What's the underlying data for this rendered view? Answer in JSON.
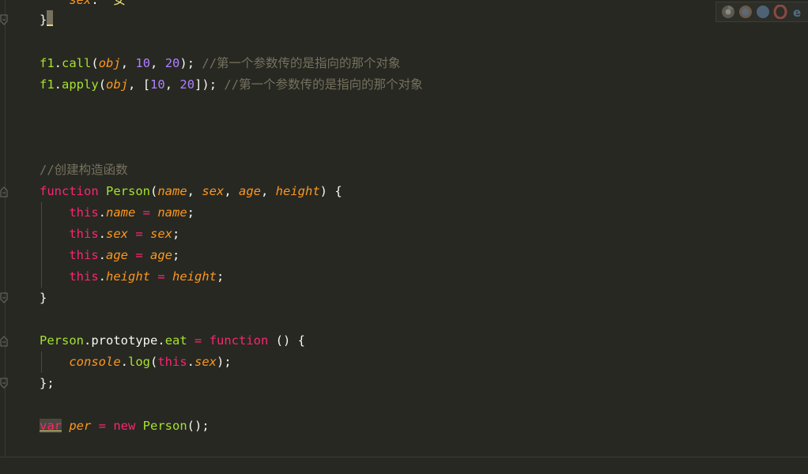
{
  "editor": {
    "lines": {
      "l0": {
        "key": "sex",
        "sep": ":",
        "val": "\"女\""
      },
      "l1": {
        "brace": "}"
      },
      "l3": {
        "obj": "f1",
        "dot": ".",
        "method": "call",
        "open": "(",
        "arg": "obj",
        "comma": ", ",
        "n1": "10",
        "comma2": ", ",
        "n2": "20",
        "close": ");",
        "comment": " //第一个参数传的是指向的那个对象"
      },
      "l4": {
        "obj": "f1",
        "dot": ".",
        "method": "apply",
        "open": "(",
        "arg": "obj",
        "comma": ", ",
        "bopen": "[",
        "n1": "10",
        "comma2": ", ",
        "n2": "20",
        "bclose": "]",
        "close": ");",
        "comment": " //第一个参数传的是指向的那个对象"
      },
      "l8": {
        "comment": "//创建构造函数"
      },
      "l9": {
        "kw": "function",
        "name": " Person",
        "open": "(",
        "p1": "name",
        "c1": ", ",
        "p2": "sex",
        "c2": ", ",
        "p3": "age",
        "c3": ", ",
        "p4": "height",
        "close": ") {"
      },
      "l10": {
        "this": "this",
        "dot": ".",
        "prop": "name",
        "eq": " = ",
        "val": "name",
        "end": ";"
      },
      "l11": {
        "this": "this",
        "dot": ".",
        "prop": "sex",
        "eq": " = ",
        "val": "sex",
        "end": ";"
      },
      "l12": {
        "this": "this",
        "dot": ".",
        "prop": "age",
        "eq": " = ",
        "val": "age",
        "end": ";"
      },
      "l13": {
        "this": "this",
        "dot": ".",
        "prop": "height",
        "eq": " = ",
        "val": "height",
        "end": ";"
      },
      "l14": {
        "brace": "}"
      },
      "l16": {
        "cls": "Person",
        "dot1": ".",
        "proto": "prototype",
        "dot2": ".",
        "method": "eat",
        "eq": " = ",
        "kw": "function",
        "rest": " () {"
      },
      "l17": {
        "console": "console",
        "dot": ".",
        "log": "log",
        "open": "(",
        "this": "this",
        "dot2": ".",
        "prop": "sex",
        "close": ");"
      },
      "l18": {
        "brace": "};"
      },
      "l20": {
        "kw": "var",
        "sp": " ",
        "vname": "per",
        "eq": " = ",
        "new": "new",
        "cls": " Person",
        "call": "();"
      }
    }
  },
  "browser_icons": [
    "chrome-icon",
    "firefox-icon",
    "safari-icon",
    "opera-icon",
    "ie-icon"
  ],
  "colors": {
    "background": "#272822",
    "function_green": "#a6e22e",
    "keyword_pink": "#f92672",
    "number_purple": "#ae81ff",
    "argument_orange": "#fd971f",
    "comment_gray": "#75715e"
  }
}
